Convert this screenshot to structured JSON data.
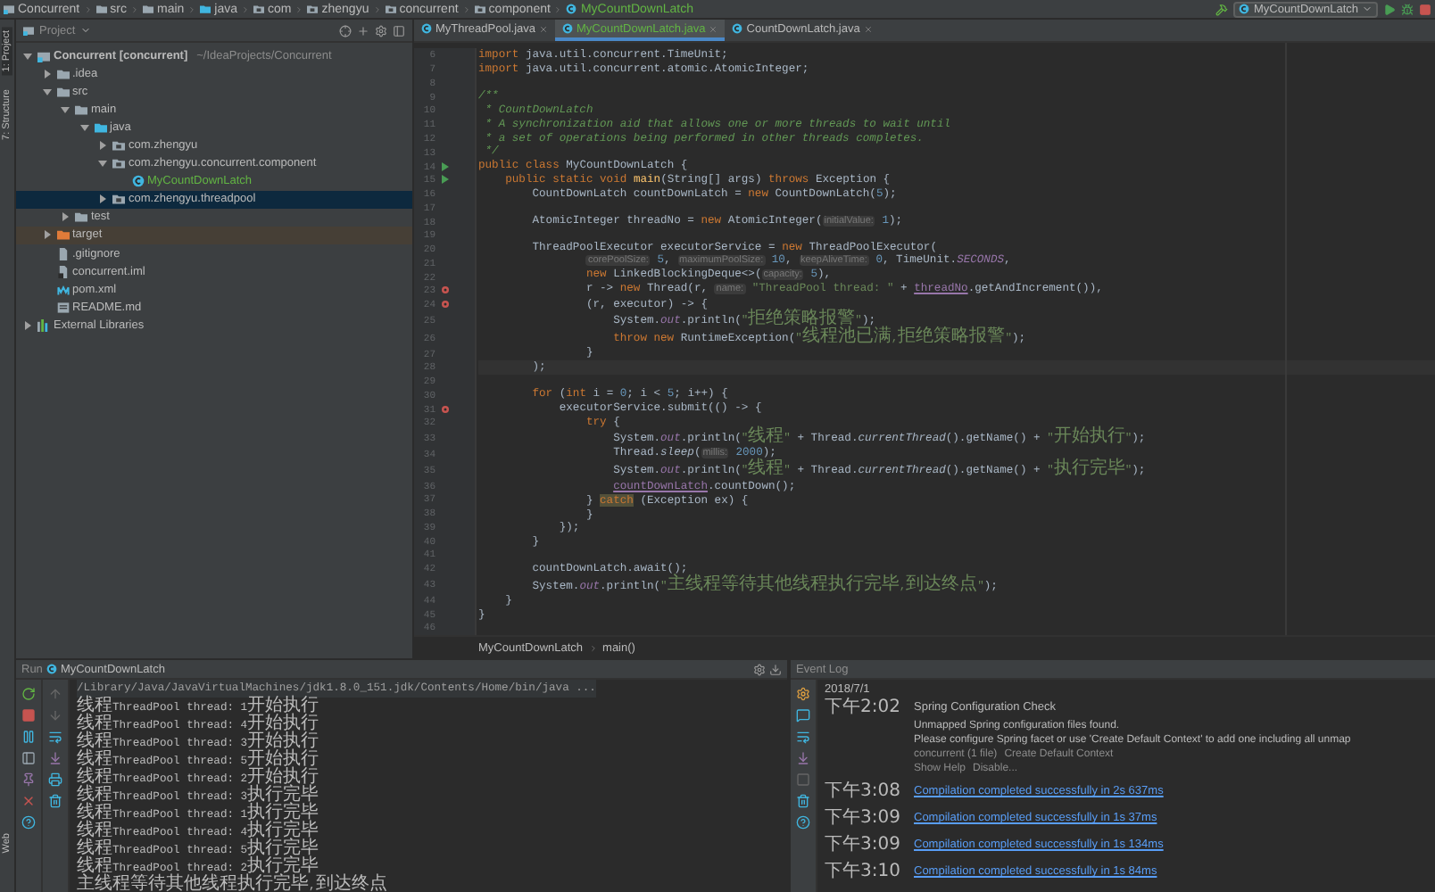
{
  "top_breadcrumb": [
    {
      "label": "Concurrent",
      "kind": "module"
    },
    {
      "label": "src",
      "kind": "folder"
    },
    {
      "label": "main",
      "kind": "folder"
    },
    {
      "label": "java",
      "kind": "java-root"
    },
    {
      "label": "com",
      "kind": "package"
    },
    {
      "label": "zhengyu",
      "kind": "package"
    },
    {
      "label": "concurrent",
      "kind": "package"
    },
    {
      "label": "component",
      "kind": "package"
    },
    {
      "label": "MyCountDownLatch",
      "kind": "class",
      "added": true
    }
  ],
  "run_config": {
    "label": "MyCountDownLatch"
  },
  "left_strip": {
    "top": [
      {
        "label": "1: Project",
        "selected": true
      },
      {
        "label": "7: Structure",
        "selected": false
      }
    ],
    "bottom": [
      {
        "label": "Web",
        "selected": false
      }
    ]
  },
  "project": {
    "title": "Project",
    "tree": [
      {
        "label": "Concurrent [concurrent]",
        "detail": "~/IdeaProjects/Concurrent",
        "kind": "module",
        "expanded": true,
        "selected": false,
        "children": [
          {
            "label": ".idea",
            "kind": "folder",
            "expanded": false,
            "selected": false
          },
          {
            "label": "src",
            "kind": "folder",
            "expanded": true,
            "selected": false,
            "children": [
              {
                "label": "main",
                "kind": "folder",
                "expanded": true,
                "selected": false,
                "children": [
                  {
                    "label": "java",
                    "kind": "java-root",
                    "expanded": true,
                    "selected": false,
                    "children": [
                      {
                        "label": "com.zhengyu",
                        "kind": "package",
                        "expanded": false,
                        "selected": false
                      },
                      {
                        "label": "com.zhengyu.concurrent.component",
                        "kind": "package",
                        "expanded": true,
                        "selected": false,
                        "children": [
                          {
                            "label": "MyCountDownLatch",
                            "kind": "class",
                            "added": true,
                            "selected": false
                          }
                        ]
                      },
                      {
                        "label": "com.zhengyu.threadpool",
                        "kind": "package",
                        "expanded": false,
                        "selected": true
                      }
                    ]
                  }
                ]
              },
              {
                "label": "test",
                "kind": "folder",
                "expanded": false,
                "selected": false
              }
            ]
          },
          {
            "label": "target",
            "kind": "target",
            "expanded": false,
            "selected": false
          },
          {
            "label": ".gitignore",
            "kind": "file",
            "selected": false
          },
          {
            "label": "concurrent.iml",
            "kind": "iml",
            "selected": false
          },
          {
            "label": "pom.xml",
            "kind": "maven",
            "selected": false
          },
          {
            "label": "README.md",
            "kind": "markdown",
            "selected": false
          }
        ]
      },
      {
        "label": "External Libraries",
        "kind": "library",
        "expanded": false,
        "selected": false
      }
    ]
  },
  "tabs": [
    {
      "label": "MyThreadPool.java",
      "selected": false,
      "added": false
    },
    {
      "label": "MyCountDownLatch.java",
      "selected": true,
      "added": true
    },
    {
      "label": "CountDownLatch.java",
      "selected": false,
      "added": false
    }
  ],
  "code": {
    "lines": [
      {
        "no": "6",
        "tokens": [
          {
            "kind": "keyword",
            "text": "import"
          },
          {
            "kind": "plain",
            "text": " java.util.concurrent.TimeUnit;"
          }
        ]
      },
      {
        "no": "7",
        "tokens": [
          {
            "kind": "keyword",
            "text": "import"
          },
          {
            "kind": "plain",
            "text": " java.util.concurrent.atomic.AtomicInteger;"
          }
        ]
      },
      {
        "no": "8"
      },
      {
        "no": "9",
        "tokens": [
          {
            "kind": "comment",
            "text": "/**"
          }
        ]
      },
      {
        "no": "10",
        "tokens": [
          {
            "kind": "comment",
            "text": " * CountDownLatch"
          }
        ]
      },
      {
        "no": "11",
        "tokens": [
          {
            "kind": "comment",
            "text": " * A synchronization aid that allows one or more threads to wait until"
          }
        ]
      },
      {
        "no": "12",
        "tokens": [
          {
            "kind": "comment",
            "text": " * a set of operations being performed in other threads completes."
          }
        ]
      },
      {
        "no": "13",
        "tokens": [
          {
            "kind": "comment",
            "text": " */"
          }
        ]
      },
      {
        "no": "14",
        "kind": "run",
        "tokens": [
          {
            "kind": "keyword",
            "text": "public class"
          },
          {
            "kind": "plain",
            "text": " MyCountDownLatch {"
          }
        ]
      },
      {
        "no": "15",
        "kind": "run",
        "tokens": [
          {
            "kind": "keyword",
            "text": "    public static void"
          },
          {
            "kind": "method",
            "text": " main"
          },
          {
            "kind": "plain",
            "text": "(String[] args) "
          },
          {
            "kind": "keyword",
            "text": "throws"
          },
          {
            "kind": "plain",
            "text": " Exception {"
          }
        ]
      },
      {
        "no": "16",
        "tokens": [
          {
            "kind": "plain",
            "text": "        CountDownLatch countDownLatch = "
          },
          {
            "kind": "keyword",
            "text": "new"
          },
          {
            "kind": "plain",
            "text": " CountDownLatch("
          },
          {
            "kind": "number",
            "text": "5"
          },
          {
            "kind": "plain",
            "text": ");"
          }
        ]
      },
      {
        "no": "17"
      },
      {
        "no": "18",
        "tokens": [
          {
            "kind": "plain",
            "text": "        AtomicInteger threadNo = "
          },
          {
            "kind": "keyword",
            "text": "new"
          },
          {
            "kind": "plain",
            "text": " AtomicInteger("
          },
          {
            "kind": "hint",
            "text": "initialValue:"
          },
          {
            "kind": "number",
            "text": " 1"
          },
          {
            "kind": "plain",
            "text": ");"
          }
        ]
      },
      {
        "no": "19"
      },
      {
        "no": "20",
        "tokens": [
          {
            "kind": "plain",
            "text": "        ThreadPoolExecutor executorService = "
          },
          {
            "kind": "keyword",
            "text": "new"
          },
          {
            "kind": "plain",
            "text": " ThreadPoolExecutor("
          }
        ]
      },
      {
        "no": "21",
        "tokens": [
          {
            "kind": "hint",
            "text": "                corePoolSize:"
          },
          {
            "kind": "number",
            "text": " 5"
          },
          {
            "kind": "plain",
            "text": ", "
          },
          {
            "kind": "hint",
            "text": "maximumPoolSize:"
          },
          {
            "kind": "number",
            "text": " 10"
          },
          {
            "kind": "plain",
            "text": ", "
          },
          {
            "kind": "hint",
            "text": "keepAliveTime:"
          },
          {
            "kind": "number",
            "text": " 0"
          },
          {
            "kind": "plain",
            "text": ", TimeUnit."
          },
          {
            "kind": "field",
            "text": "SECONDS"
          },
          {
            "kind": "plain",
            "text": ","
          }
        ]
      },
      {
        "no": "22",
        "tokens": [
          {
            "kind": "keyword",
            "text": "                new"
          },
          {
            "kind": "plain",
            "text": " LinkedBlockingDeque<>("
          },
          {
            "kind": "hint",
            "text": "capacity:"
          },
          {
            "kind": "number",
            "text": " 5"
          },
          {
            "kind": "plain",
            "text": "),"
          }
        ]
      },
      {
        "no": "23",
        "kind": "breakpoint",
        "tokens": [
          {
            "kind": "plain",
            "text": "                r -> "
          },
          {
            "kind": "keyword",
            "text": "new"
          },
          {
            "kind": "plain",
            "text": " Thread(r, "
          },
          {
            "kind": "hint",
            "text": "name:"
          },
          {
            "kind": "string",
            "text": " \"ThreadPool thread: \""
          },
          {
            "kind": "plain",
            "text": " + "
          },
          {
            "kind": "variable",
            "text": "threadNo"
          },
          {
            "kind": "plain",
            "text": ".getAndIncrement()),"
          }
        ]
      },
      {
        "no": "24",
        "kind": "breakpoint",
        "tokens": [
          {
            "kind": "plain",
            "text": "                (r, executor) -> {"
          }
        ]
      },
      {
        "no": "25",
        "tokens": [
          {
            "kind": "plain",
            "text": "                    System."
          },
          {
            "kind": "field",
            "text": "out"
          },
          {
            "kind": "plain",
            "text": ".println("
          },
          {
            "kind": "string",
            "text": "\"拒绝策略报警\""
          },
          {
            "kind": "plain",
            "text": ");"
          }
        ]
      },
      {
        "no": "26",
        "tokens": [
          {
            "kind": "keyword",
            "text": "                    throw new"
          },
          {
            "kind": "plain",
            "text": " RuntimeException("
          },
          {
            "kind": "string",
            "text": "\"线程池已满,拒绝策略报警\""
          },
          {
            "kind": "plain",
            "text": ");"
          }
        ]
      },
      {
        "no": "27",
        "tokens": [
          {
            "kind": "plain",
            "text": "                }"
          }
        ]
      },
      {
        "no": "28",
        "current": true,
        "tokens": [
          {
            "kind": "plain",
            "text": "        );"
          }
        ]
      },
      {
        "no": "29"
      },
      {
        "no": "30",
        "tokens": [
          {
            "kind": "keyword",
            "text": "        for"
          },
          {
            "kind": "plain",
            "text": " ("
          },
          {
            "kind": "keyword",
            "text": "int"
          },
          {
            "kind": "plain",
            "text": " i = "
          },
          {
            "kind": "number",
            "text": "0"
          },
          {
            "kind": "plain",
            "text": "; i < "
          },
          {
            "kind": "number",
            "text": "5"
          },
          {
            "kind": "plain",
            "text": "; i++) {"
          }
        ]
      },
      {
        "no": "31",
        "kind": "breakpoint",
        "tokens": [
          {
            "kind": "plain",
            "text": "            executorService.submit(() -> {"
          }
        ]
      },
      {
        "no": "32",
        "tokens": [
          {
            "kind": "keyword",
            "text": "                try"
          },
          {
            "kind": "plain",
            "text": " {"
          }
        ]
      },
      {
        "no": "33",
        "tokens": [
          {
            "kind": "plain",
            "text": "                    System."
          },
          {
            "kind": "field",
            "text": "out"
          },
          {
            "kind": "plain",
            "text": ".println("
          },
          {
            "kind": "string",
            "text": "\"线程\""
          },
          {
            "kind": "plain",
            "text": " + Thread."
          },
          {
            "kind": "static",
            "text": "currentThread"
          },
          {
            "kind": "plain",
            "text": "().getName() + "
          },
          {
            "kind": "string",
            "text": "\"开始执行\""
          },
          {
            "kind": "plain",
            "text": ");"
          }
        ]
      },
      {
        "no": "34",
        "tokens": [
          {
            "kind": "plain",
            "text": "                    Thread."
          },
          {
            "kind": "static",
            "text": "sleep"
          },
          {
            "kind": "plain",
            "text": "("
          },
          {
            "kind": "hint",
            "text": "millis:"
          },
          {
            "kind": "number",
            "text": " 2000"
          },
          {
            "kind": "plain",
            "text": ");"
          }
        ]
      },
      {
        "no": "35",
        "tokens": [
          {
            "kind": "plain",
            "text": "                    System."
          },
          {
            "kind": "field",
            "text": "out"
          },
          {
            "kind": "plain",
            "text": ".println("
          },
          {
            "kind": "string",
            "text": "\"线程\""
          },
          {
            "kind": "plain",
            "text": " + Thread."
          },
          {
            "kind": "static",
            "text": "currentThread"
          },
          {
            "kind": "plain",
            "text": "().getName() + "
          },
          {
            "kind": "string",
            "text": "\"执行完毕\""
          },
          {
            "kind": "plain",
            "text": ");"
          }
        ]
      },
      {
        "no": "36",
        "tokens": [
          {
            "kind": "variable",
            "text": "                    countDownLatch"
          },
          {
            "kind": "plain",
            "text": ".countDown();"
          }
        ]
      },
      {
        "no": "37",
        "tokens": [
          {
            "kind": "plain",
            "text": "                } "
          },
          {
            "kind": "highlight",
            "text": "catch"
          },
          {
            "kind": "plain",
            "text": " (Exception ex) {"
          }
        ]
      },
      {
        "no": "38",
        "tokens": [
          {
            "kind": "plain",
            "text": "                }"
          }
        ]
      },
      {
        "no": "39",
        "tokens": [
          {
            "kind": "plain",
            "text": "            });"
          }
        ]
      },
      {
        "no": "40",
        "tokens": [
          {
            "kind": "plain",
            "text": "        }"
          }
        ]
      },
      {
        "no": "41"
      },
      {
        "no": "42",
        "tokens": [
          {
            "kind": "plain",
            "text": "        countDownLatch.await();"
          }
        ]
      },
      {
        "no": "43",
        "tokens": [
          {
            "kind": "plain",
            "text": "        System."
          },
          {
            "kind": "field",
            "text": "out"
          },
          {
            "kind": "plain",
            "text": ".println("
          },
          {
            "kind": "string",
            "text": "\"主线程等待其他线程执行完毕,到达终点\""
          },
          {
            "kind": "plain",
            "text": ");"
          }
        ]
      },
      {
        "no": "44",
        "tokens": [
          {
            "kind": "plain",
            "text": "    }"
          }
        ]
      },
      {
        "no": "45",
        "tokens": [
          {
            "kind": "plain",
            "text": "}"
          }
        ]
      },
      {
        "no": "46"
      }
    ]
  },
  "editor_breadcrumb": [
    "MyCountDownLatch",
    "main()"
  ],
  "run": {
    "title": "Run",
    "config": "MyCountDownLatch",
    "lines": [
      {
        "kind": "command",
        "text": "/Library/Java/JavaVirtualMachines/jdk1.8.0_151.jdk/Contents/Home/bin/java ..."
      },
      {
        "kind": "output",
        "text": "线程ThreadPool thread: 1开始执行"
      },
      {
        "kind": "output",
        "text": "线程ThreadPool thread: 4开始执行"
      },
      {
        "kind": "output",
        "text": "线程ThreadPool thread: 3开始执行"
      },
      {
        "kind": "output",
        "text": "线程ThreadPool thread: 5开始执行"
      },
      {
        "kind": "output",
        "text": "线程ThreadPool thread: 2开始执行"
      },
      {
        "kind": "output",
        "text": "线程ThreadPool thread: 3执行完毕"
      },
      {
        "kind": "output",
        "text": "线程ThreadPool thread: 1执行完毕"
      },
      {
        "kind": "output",
        "text": "线程ThreadPool thread: 4执行完毕"
      },
      {
        "kind": "output",
        "text": "线程ThreadPool thread: 5执行完毕"
      },
      {
        "kind": "output",
        "text": "线程ThreadPool thread: 2执行完毕"
      },
      {
        "kind": "output",
        "text": "主线程等待其他线程执行完毕,到达终点"
      }
    ]
  },
  "event_log": {
    "title": "Event Log",
    "date": "2018/7/1",
    "entries": [
      {
        "kind": "notice",
        "time": "下午2:02",
        "title": "Spring Configuration Check",
        "body": [
          "Unmapped Spring configuration files found.",
          "Please configure Spring facet or use 'Create Default Context' to add one including all unmap"
        ],
        "file": "concurrent (1 file)",
        "actions": [
          "Create Default Context"
        ],
        "links": [
          "Show Help",
          "Disable..."
        ]
      },
      {
        "kind": "link",
        "time": "下午3:08",
        "text": "Compilation completed successfully in 2s 637ms"
      },
      {
        "kind": "link",
        "time": "下午3:09",
        "text": "Compilation completed successfully in 1s 37ms"
      },
      {
        "kind": "link",
        "time": "下午3:09",
        "text": "Compilation completed successfully in 1s 134ms"
      },
      {
        "kind": "link",
        "time": "下午3:10",
        "text": "Compilation completed successfully in 1s 84ms"
      }
    ]
  }
}
